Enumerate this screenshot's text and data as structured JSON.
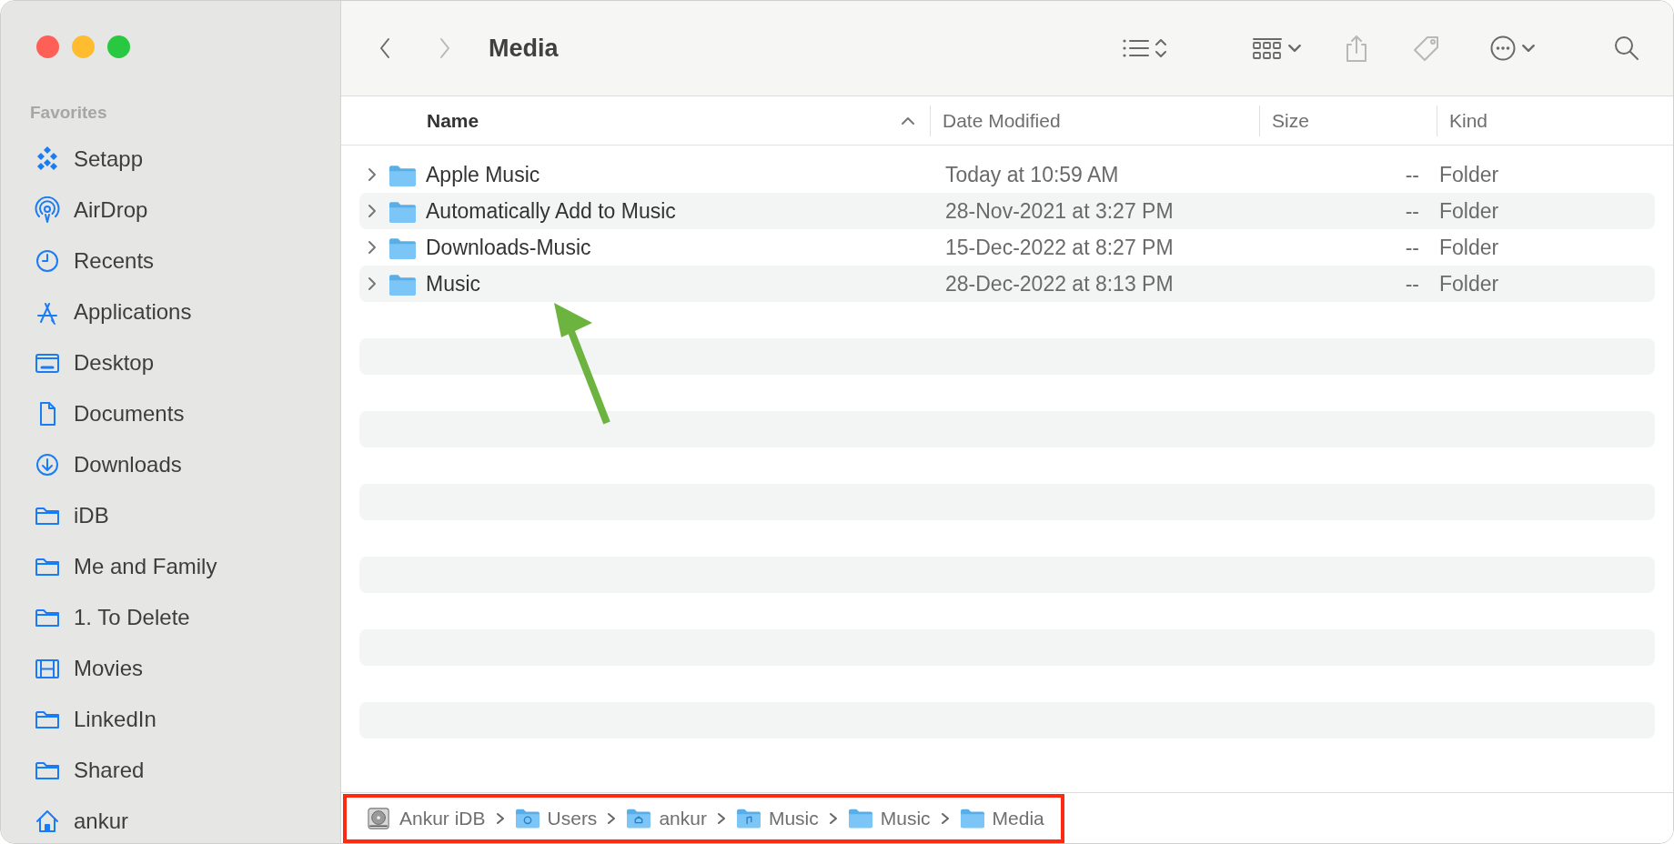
{
  "window": {
    "title": "Media",
    "traffic_lights": [
      {
        "color": "#fe5f57"
      },
      {
        "color": "#febc2e"
      },
      {
        "color": "#28c840"
      }
    ]
  },
  "toolbar": [
    {
      "kind": "back",
      "disabled": false
    },
    {
      "kind": "forward",
      "disabled": true
    },
    {
      "kind": "title"
    },
    {
      "kind": "list-view",
      "disabled": false
    },
    {
      "kind": "grid-view",
      "disabled": false
    },
    {
      "kind": "share",
      "disabled": true
    },
    {
      "kind": "tag",
      "disabled": true
    },
    {
      "kind": "more",
      "disabled": false
    },
    {
      "kind": "search",
      "disabled": false
    }
  ],
  "sidebar": {
    "section": "Favorites",
    "items": [
      {
        "label": "Setapp",
        "kind": "setapp"
      },
      {
        "label": "AirDrop",
        "kind": "airdrop"
      },
      {
        "label": "Recents",
        "kind": "clock"
      },
      {
        "label": "Applications",
        "kind": "apps"
      },
      {
        "label": "Desktop",
        "kind": "desktop"
      },
      {
        "label": "Documents",
        "kind": "document"
      },
      {
        "label": "Downloads",
        "kind": "download"
      },
      {
        "label": "iDB",
        "kind": "folder"
      },
      {
        "label": "Me and Family",
        "kind": "folder"
      },
      {
        "label": "1. To Delete",
        "kind": "folder"
      },
      {
        "label": "Movies",
        "kind": "film"
      },
      {
        "label": "LinkedIn",
        "kind": "folder"
      },
      {
        "label": "Shared",
        "kind": "folder"
      },
      {
        "label": "ankur",
        "kind": "home"
      }
    ]
  },
  "table": {
    "columns": [
      {
        "label": "Name",
        "sorted": true
      },
      {
        "label": "Date Modified",
        "sorted": false
      },
      {
        "label": "Size",
        "sorted": false
      },
      {
        "label": "Kind",
        "sorted": false
      }
    ],
    "rows": [
      {
        "name": "Apple Music",
        "date": "Today at 10:59 AM",
        "size": "--",
        "kind": "Folder",
        "expanded": false
      },
      {
        "name": "Automatically Add to Music",
        "date": "28-Nov-2021 at 3:27 PM",
        "size": "--",
        "kind": "Folder",
        "expanded": false
      },
      {
        "name": "Downloads-Music",
        "date": "15-Dec-2022 at 8:27 PM",
        "size": "--",
        "kind": "Folder",
        "expanded": false
      },
      {
        "name": "Music",
        "date": "28-Dec-2022 at 8:13 PM",
        "size": "--",
        "kind": "Folder",
        "expanded": false
      }
    ]
  },
  "path_bar": [
    {
      "label": "Ankur iDB",
      "kind": "disk"
    },
    {
      "label": "Users",
      "kind": "folder-users"
    },
    {
      "label": "ankur",
      "kind": "folder-home"
    },
    {
      "label": "Music",
      "kind": "folder-music"
    },
    {
      "label": "Music",
      "kind": "folder"
    },
    {
      "label": "Media",
      "kind": "folder"
    }
  ],
  "annotations": [
    {
      "kind": "arrow",
      "color": "#6cb43f"
    },
    {
      "kind": "frame",
      "color": "#ff2a10"
    }
  ]
}
